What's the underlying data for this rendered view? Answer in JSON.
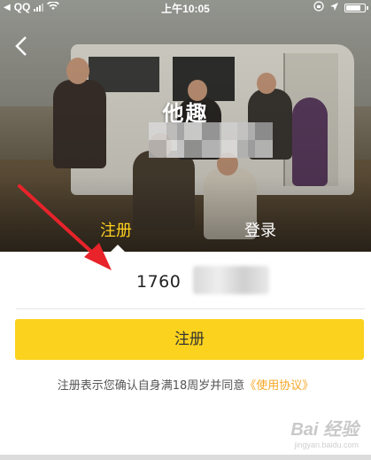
{
  "status_bar": {
    "carrier": "QQ",
    "time": "上午10:05"
  },
  "title": "他趣",
  "tabs": {
    "register": "注册",
    "login": "登录"
  },
  "form": {
    "phone_value": "1760"
  },
  "button": {
    "submit": "注册"
  },
  "agreement": {
    "text": "注册表示您确认自身满18周岁并同意",
    "link": "《使用协议》"
  },
  "watermark": {
    "brand": "Bai 经验",
    "url": "jingyan.baidu.com"
  },
  "colors": {
    "accent": "#fbd21d",
    "tab_active": "#ffd21f",
    "link": "#f5a623",
    "arrow": "#e8232a"
  }
}
